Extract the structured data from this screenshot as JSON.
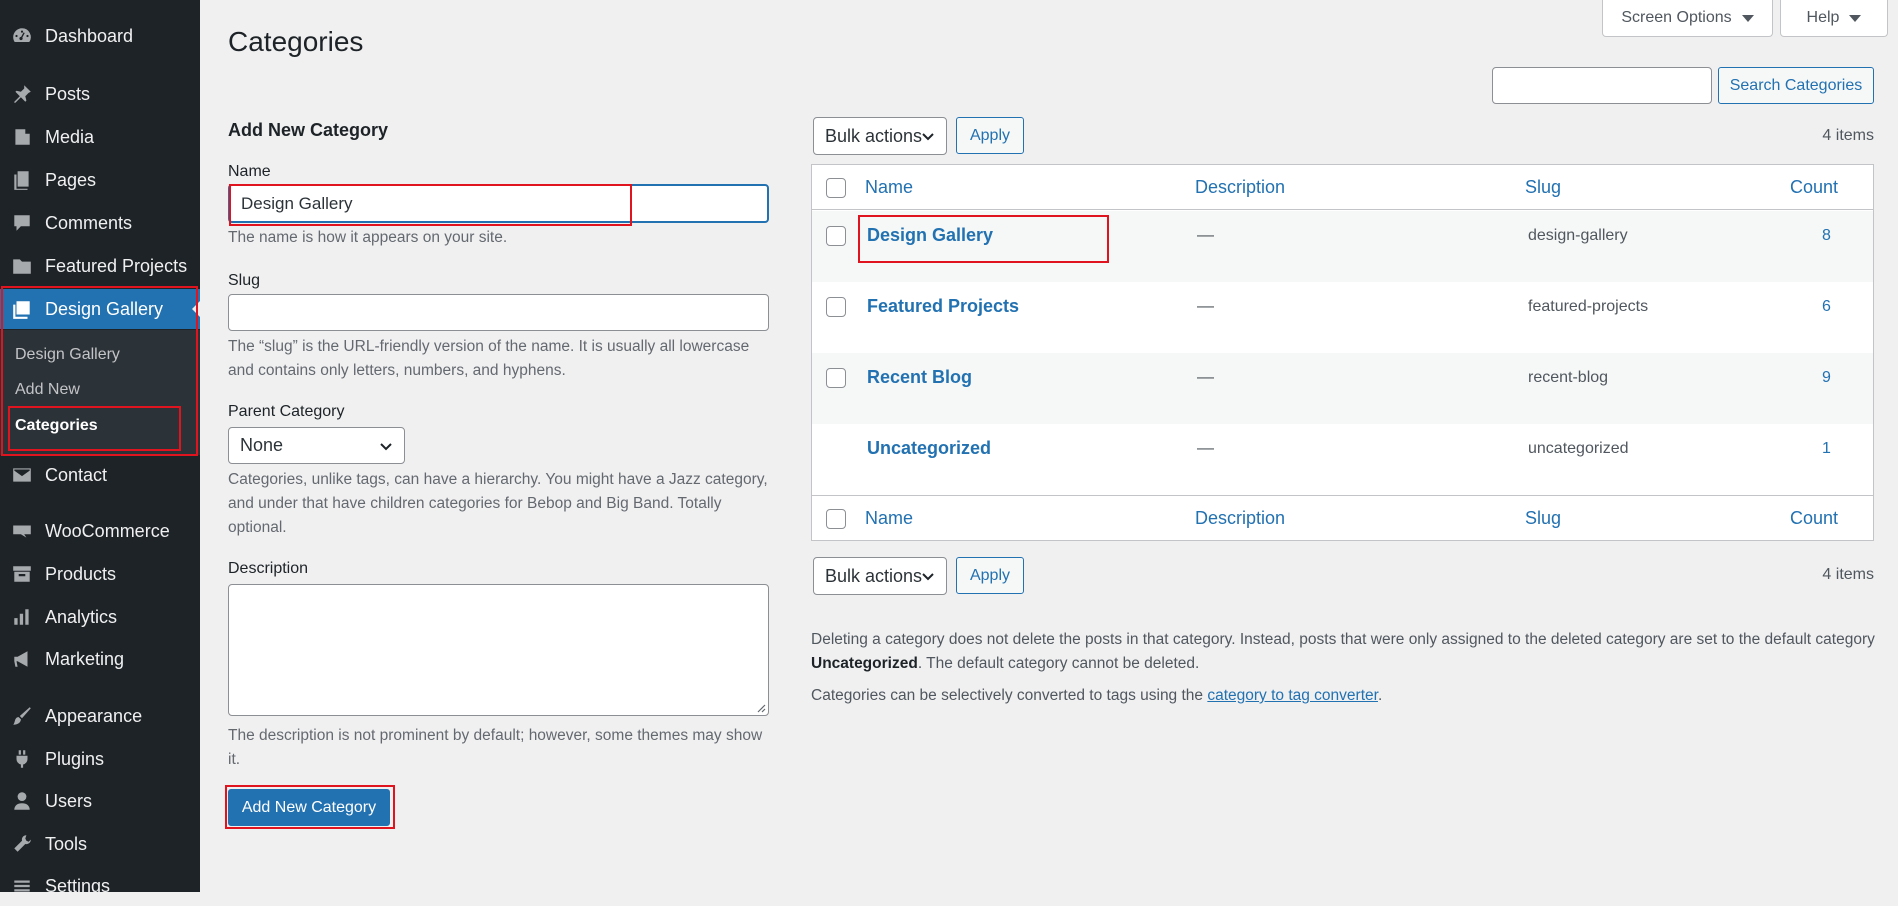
{
  "sidebar": {
    "items": [
      {
        "label": "Dashboard",
        "icon": "dashboard-icon"
      },
      {
        "label": "Posts",
        "icon": "pin-icon"
      },
      {
        "label": "Media",
        "icon": "media-icon"
      },
      {
        "label": "Pages",
        "icon": "pages-icon"
      },
      {
        "label": "Comments",
        "icon": "comment-icon"
      },
      {
        "label": "Featured Projects",
        "icon": "folder-icon"
      },
      {
        "label": "Design Gallery",
        "icon": "gallery-icon",
        "current": true
      },
      {
        "label": "Contact",
        "icon": "mail-icon"
      },
      {
        "label": "WooCommerce",
        "icon": "woo-icon"
      },
      {
        "label": "Products",
        "icon": "archive-icon"
      },
      {
        "label": "Analytics",
        "icon": "bar-chart-icon"
      },
      {
        "label": "Marketing",
        "icon": "megaphone-icon"
      },
      {
        "label": "Appearance",
        "icon": "brush-icon"
      },
      {
        "label": "Plugins",
        "icon": "plugin-icon"
      },
      {
        "label": "Users",
        "icon": "user-icon"
      },
      {
        "label": "Tools",
        "icon": "wrench-icon"
      },
      {
        "label": "Settings",
        "icon": "settings-icon"
      }
    ],
    "submenu": [
      "Design Gallery",
      "Add New",
      "Categories"
    ]
  },
  "header": {
    "screen_options": "Screen Options",
    "help": "Help",
    "title": "Categories"
  },
  "search": {
    "value": "",
    "button": "Search Categories"
  },
  "form": {
    "heading": "Add New Category",
    "name_label": "Name",
    "name_value": "Design Gallery",
    "name_help": "The name is how it appears on your site.",
    "slug_label": "Slug",
    "slug_value": "",
    "slug_help": "The “slug” is the URL-friendly version of the name. It is usually all lowercase and contains only letters, numbers, and hyphens.",
    "parent_label": "Parent Category",
    "parent_value": "None",
    "parent_help": "Categories, unlike tags, can have a hierarchy. You might have a Jazz category, and under that have children categories for Bebop and Big Band. Totally optional.",
    "description_label": "Description",
    "description_help": "The description is not prominent by default; however, some themes may show it.",
    "submit": "Add New Category"
  },
  "table": {
    "bulk_actions": "Bulk actions",
    "apply": "Apply",
    "items_count": "4 items",
    "columns": [
      "Name",
      "Description",
      "Slug",
      "Count"
    ],
    "rows": [
      {
        "name": "Design Gallery",
        "description": "—",
        "slug": "design-gallery",
        "count": "8",
        "checkbox": true
      },
      {
        "name": "Featured Projects",
        "description": "—",
        "slug": "featured-projects",
        "count": "6",
        "checkbox": true
      },
      {
        "name": "Recent Blog",
        "description": "—",
        "slug": "recent-blog",
        "count": "9",
        "checkbox": true
      },
      {
        "name": "Uncategorized",
        "description": "—",
        "slug": "uncategorized",
        "count": "1",
        "checkbox": false
      }
    ]
  },
  "notes": {
    "delete_note_part1": "Deleting a category does not delete the posts in that category. Instead, posts that were only assigned to the deleted category are set to the default category ",
    "delete_note_bold": "Uncategorized",
    "delete_note_part2": ". The default category cannot be deleted.",
    "convert_note_prefix": "Categories can be selectively converted to tags using the ",
    "convert_link": "category to tag converter",
    "convert_note_suffix": "."
  },
  "colors": {
    "sidebar_bg": "#1d2327",
    "accent": "#2271b1",
    "highlight": "#e0141e",
    "page_bg": "#f0f0f1"
  }
}
